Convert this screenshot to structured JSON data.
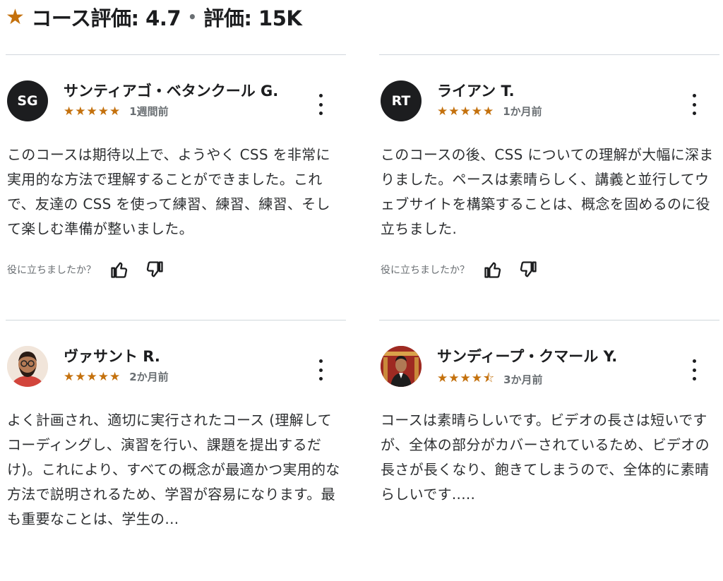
{
  "header": {
    "title": "コース評価: 4.7",
    "separator": "•",
    "ratings_count": "評価: 15K",
    "star_icon": "★"
  },
  "colors": {
    "star": "#c4710d",
    "text": "#1c1d1f",
    "muted": "#6a6f73",
    "divider": "#d1d7dc"
  },
  "helpful_label": "役に立ちましたか？",
  "reviews": [
    {
      "initials": "SG",
      "name": "サンティアゴ・ベタンクール G.",
      "rating": 5,
      "date": "1週間前",
      "text": "このコースは期待以上で、ようやく CSS を非常に実用的な方法で理解することができました。これで、友達の CSS を使って練習、練習、練習、そして楽しむ準備が整いました。"
    },
    {
      "initials": "RT",
      "name": "ライアン T.",
      "rating": 5,
      "date": "1か月前",
      "text": "このコースの後、CSS についての理解が大幅に深まりました。ペースは素晴らしく、講義と並行してウェブサイトを構築することは、概念を固めるのに役立ちました."
    },
    {
      "initials": "",
      "avatar": "photo-avatar-bearded-man",
      "name": "ヴァサント R.",
      "rating": 5,
      "date": "2か月前",
      "text": "よく計画され、適切に実行されたコース (理解してコーディングし、演習を行い、課題を提出するだけ)。これにより、すべての概念が最適かつ実用的な方法で説明されるため、学習が容易になります。最も重要なことは、学生の…"
    },
    {
      "initials": "",
      "avatar": "photo-avatar-man-red-background",
      "name": "サンディープ・クマール Y.",
      "rating": 4.5,
      "date": "3か月前",
      "text": "コースは素晴らしいです。ビデオの長さは短いですが、全体の部分がカバーされているため、ビデオの長さが長くなり、飽きてしまうので、全体的に素晴らしいです....."
    }
  ]
}
